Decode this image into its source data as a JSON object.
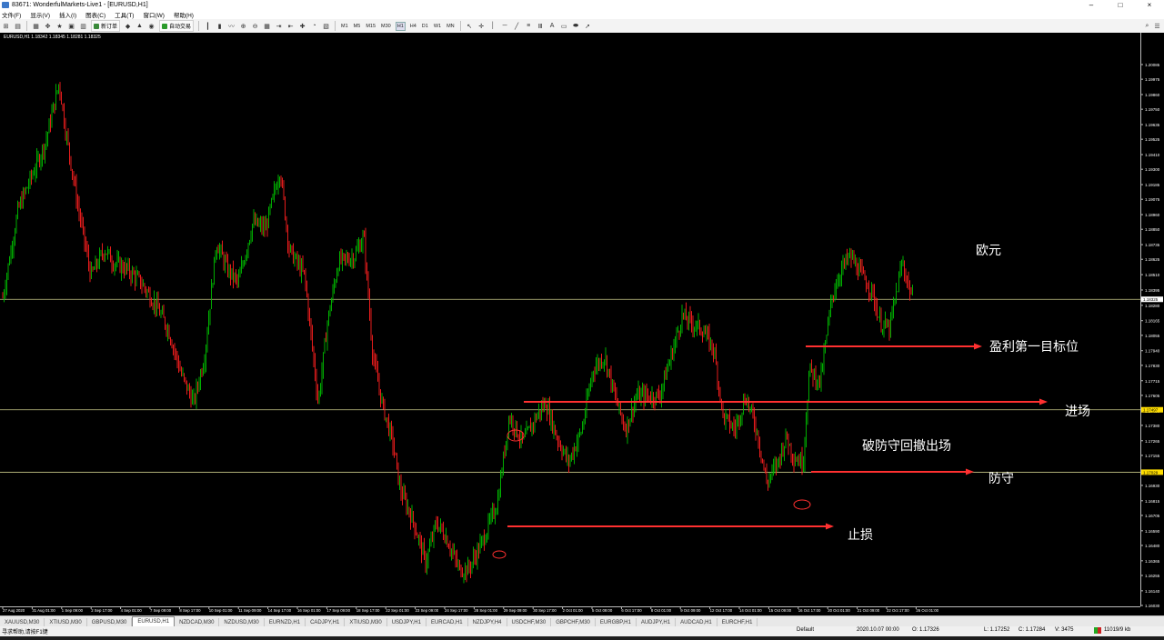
{
  "window": {
    "title": "83671: WonderfulMarkets-Live1 - [EURUSD,H1]",
    "min": "–",
    "max": "□",
    "close": "×"
  },
  "menu": [
    "文件(F)",
    "显示(V)",
    "插入(I)",
    "图表(C)",
    "工具(T)",
    "窗口(W)",
    "帮助(H)"
  ],
  "toolbar": {
    "new_order": "新订单",
    "auto_trade": "自动交易",
    "timeframes": [
      "M1",
      "M5",
      "M15",
      "M30",
      "H1",
      "H4",
      "D1",
      "W1",
      "MN"
    ],
    "active_timeframe": "H1"
  },
  "chart": {
    "info": "EURUSD,H1  1.18342 1.18345 1.18281 1.18325",
    "colors": {
      "up": "#00c000",
      "down": "#ff2020",
      "hline": "#c8c888",
      "arrow": "#ff3030",
      "text": "#ffffff"
    },
    "price_labels": [
      "1.20085",
      "1.19975",
      "1.19860",
      "1.19750",
      "1.19635",
      "1.19525",
      "1.19410",
      "1.19300",
      "1.19185",
      "1.19075",
      "1.18960",
      "1.18850",
      "1.18735",
      "1.18625",
      "1.18510",
      "1.18395",
      "1.18280",
      "1.18165",
      "1.18055",
      "1.17940",
      "1.17830",
      "1.17715",
      "1.17605",
      "1.17490",
      "1.17380",
      "1.17265",
      "1.17155",
      "1.17040",
      "1.16930",
      "1.16815",
      "1.16705",
      "1.16590",
      "1.16480",
      "1.16365",
      "1.16255",
      "1.16140",
      "1.16030"
    ],
    "current_price": "1.18325",
    "entry_price": "1.17497",
    "stop_price": "1.17029",
    "time_labels": [
      "27 Aug 2020",
      "31 Aug 01:00",
      "1 Sep 09:00",
      "2 Sep 17:00",
      "4 Sep 01:00",
      "7 Sep 09:00",
      "8 Sep 17:00",
      "10 Sep 01:00",
      "11 Sep 09:00",
      "14 Sep 17:00",
      "16 Sep 01:00",
      "17 Sep 09:00",
      "18 Sep 17:00",
      "22 Sep 01:00",
      "23 Sep 09:00",
      "24 Sep 17:00",
      "28 Sep 01:00",
      "29 Sep 09:00",
      "30 Sep 17:00",
      "2 Oct 01:00",
      "5 Oct 09:00",
      "6 Oct 17:00",
      "8 Oct 01:00",
      "9 Oct 09:00",
      "12 Oct 17:00",
      "14 Oct 01:00",
      "15 Oct 09:00",
      "16 Oct 17:00",
      "20 Oct 01:00",
      "21 Oct 09:00",
      "22 Oct 17:00",
      "26 Oct 01:00"
    ],
    "annotations": {
      "euro": "欧元",
      "target": "盈利第一目标位",
      "entry": "进场",
      "exit_note": "破防守回撤出场",
      "defense": "防守",
      "stop": "止损"
    }
  },
  "tabs": [
    "XAUUSD,M30",
    "XTIUSD,M30",
    "GBPUSD,M30",
    "EURUSD,H1",
    "NZDCAD,M30",
    "NZDUSD,M30",
    "EURNZD,H1",
    "CADJPY,H1",
    "XTIUSD,M30",
    "USDJPY,H1",
    "EURCAD,H1",
    "NZDJPY,H4",
    "USDCHF,M30",
    "GBPCHF,M30",
    "EURGBP,H1",
    "AUDJPY,H1",
    "AUDCAD,H1",
    "EURCHF,H1"
  ],
  "active_tab": "EURUSD,H1",
  "status": {
    "help": "寻求帮助,请按F1键",
    "profile": "Default",
    "datetime": "2020.10.07 00:00",
    "open": "O: 1.17326",
    "low": "L: 1.17252",
    "close": "C: 1.17284",
    "volume": "V: 3475",
    "traffic": "11019/9 kb"
  }
}
